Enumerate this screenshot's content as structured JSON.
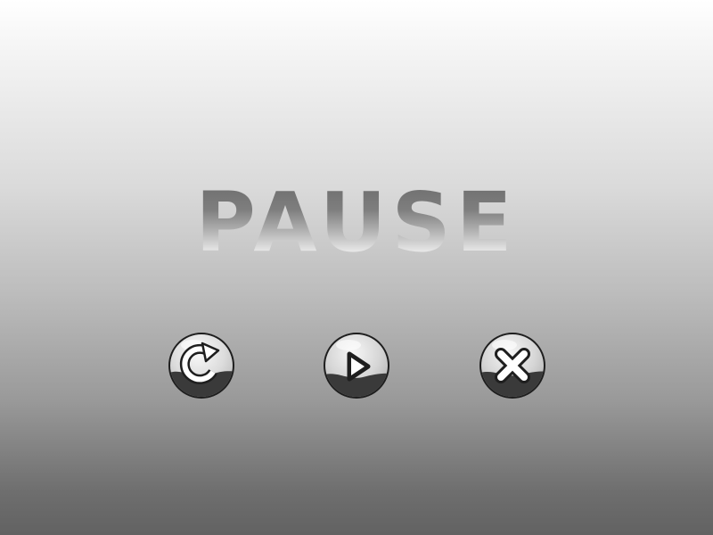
{
  "title": "PAUSE",
  "buttons": [
    {
      "id": "restart",
      "icon": "restart-arrow-icon"
    },
    {
      "id": "resume",
      "icon": "play-icon"
    },
    {
      "id": "quit",
      "icon": "close-x-icon"
    }
  ],
  "colors": {
    "bubble_light": "#e2e2e2",
    "bubble_dark": "#3a3a3a",
    "outline": "#1e1e1e"
  }
}
